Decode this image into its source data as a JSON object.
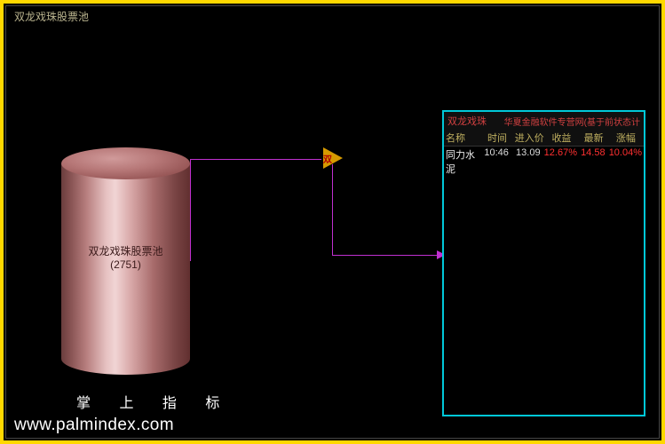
{
  "title": "双龙戏珠股票池",
  "cylinder": {
    "label_line1": "双龙戏珠股票池",
    "label_line2": "(2751)"
  },
  "triangle_label": "双",
  "panel": {
    "title_left": "双龙戏珠",
    "title_right": "华夏金融软件专营网(基于前状态计",
    "columns": {
      "c0": "名称",
      "c1": "时间",
      "c2": "进入价",
      "c3": "收益",
      "c4": "最新",
      "c5": "涨幅"
    },
    "rows": [
      {
        "c0": "同力水泥",
        "c1": "10:46",
        "c2": "13.09",
        "c3": "12.67%",
        "c4": "14.58",
        "c5": "10.04%"
      }
    ]
  },
  "footer_cn": "掌 上 指 标",
  "footer_url": "www.palmindex.com"
}
